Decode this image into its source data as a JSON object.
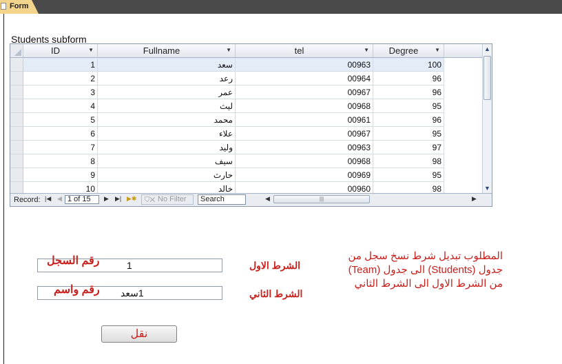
{
  "tab": {
    "label": "Form"
  },
  "subform": {
    "label": "Students subform"
  },
  "grid": {
    "columns": [
      {
        "label": "ID"
      },
      {
        "label": "Fullname"
      },
      {
        "label": "tel"
      },
      {
        "label": "Degree"
      }
    ],
    "rows": [
      {
        "id": "1",
        "fullname": "سعد",
        "tel": "00963",
        "degree": "100"
      },
      {
        "id": "2",
        "fullname": "رعد",
        "tel": "00964",
        "degree": "96"
      },
      {
        "id": "3",
        "fullname": "عمر",
        "tel": "00967",
        "degree": "96"
      },
      {
        "id": "4",
        "fullname": "ليث",
        "tel": "00968",
        "degree": "95"
      },
      {
        "id": "5",
        "fullname": "محمد",
        "tel": "00961",
        "degree": "96"
      },
      {
        "id": "6",
        "fullname": "علاء",
        "tel": "00967",
        "degree": "95"
      },
      {
        "id": "7",
        "fullname": "وليد",
        "tel": "00963",
        "degree": "97"
      },
      {
        "id": "8",
        "fullname": "سيف",
        "tel": "00968",
        "degree": "98"
      },
      {
        "id": "9",
        "fullname": "حارث",
        "tel": "00969",
        "degree": "95"
      },
      {
        "id": "10",
        "fullname": "خالد",
        "tel": "00960",
        "degree": "98"
      }
    ]
  },
  "navigation": {
    "record_label": "Record:",
    "record_value": "1 of 15",
    "filter_label": "No Filter",
    "search_placeholder": "Search",
    "first_icon": "first-record-icon",
    "prev_icon": "prev-record-icon",
    "next_icon": "next-record-icon",
    "last_icon": "last-record-icon",
    "new_icon": "new-record-icon"
  },
  "form": {
    "record_number_label": "رقم السجل",
    "record_number_value": "1",
    "first_condition_label": "الشرط الاول",
    "number_and_name_label": "رقم واسم",
    "number_and_name_value": "1سعد",
    "second_condition_label": "الشرط الثاني",
    "transfer_button": "نقل"
  },
  "note": {
    "line1": "المطلوب تبديل شرط نسخ سجل من",
    "line2": "جدول (Students) الى جدول (Team)",
    "line3": "من الشرط الاول الى الشرط الثاني"
  },
  "colors": {
    "accent_red": "#c8201c",
    "tab": "#f3d48c",
    "topbar": "#4a4a4a"
  }
}
